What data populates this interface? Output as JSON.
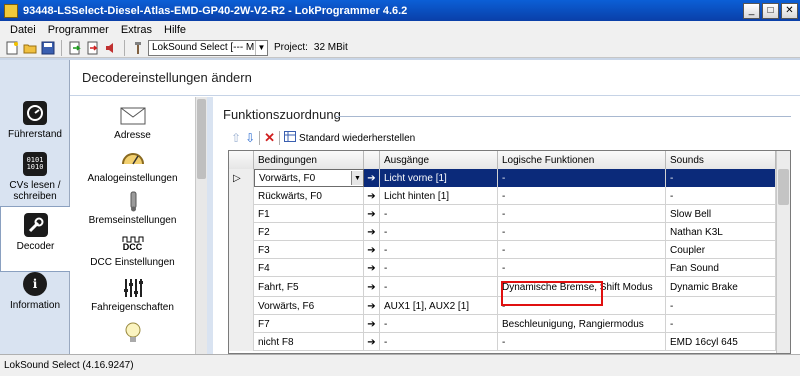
{
  "window": {
    "title": "93448-LSSelect-Diesel-Atlas-EMD-GP40-2W-V2-R2 - LokProgrammer 4.6.2",
    "btn_min": "_",
    "btn_max": "□",
    "btn_close": "✕"
  },
  "menu": [
    "Datei",
    "Programmer",
    "Extras",
    "Hilfe"
  ],
  "toolbar": {
    "decoder_select": "LokSound Select [--- MBit]",
    "project_label": "Project:",
    "project_value": "32 MBit"
  },
  "nav": [
    {
      "label": "Führerstand",
      "icon": "gauge-icon"
    },
    {
      "label": "CVs lesen / schreiben",
      "icon": "binary-icon"
    },
    {
      "label": "Decoder",
      "icon": "wrench-icon",
      "active": true
    },
    {
      "label": "Information",
      "icon": "info-icon"
    }
  ],
  "main": {
    "header": "Decodereinstellungen ändern"
  },
  "categories": [
    {
      "label": "Adresse",
      "icon": "envelope-icon"
    },
    {
      "label": "Analogeinstellungen",
      "icon": "analog-meter-icon"
    },
    {
      "label": "Bremseinstellungen",
      "icon": "brake-icon"
    },
    {
      "label": "DCC Einstellungen",
      "icon": "dcc-icon"
    },
    {
      "label": "Fahreigenschaften",
      "icon": "sliders-icon"
    },
    {
      "label": "",
      "icon": "lightbulb-icon"
    }
  ],
  "content": {
    "section_title": "Funktionszuordnung",
    "restore_label": "Standard wiederherstellen"
  },
  "grid": {
    "headers": [
      "",
      "Bedingungen",
      "",
      "Ausgänge",
      "Logische Funktionen",
      "Sounds"
    ],
    "rows": [
      {
        "indicator": "▷",
        "cond": "Vorwärts, F0",
        "arrow": "➔",
        "out": "Licht vorne [1]",
        "logic": "-",
        "sound": "-",
        "selected": true
      },
      {
        "indicator": "",
        "cond": "Rückwärts, F0",
        "arrow": "➔",
        "out": "Licht hinten [1]",
        "logic": "-",
        "sound": "-"
      },
      {
        "indicator": "",
        "cond": "F1",
        "arrow": "➔",
        "out": "-",
        "logic": "-",
        "sound": "Slow Bell"
      },
      {
        "indicator": "",
        "cond": "F2",
        "arrow": "➔",
        "out": "-",
        "logic": "-",
        "sound": "Nathan K3L"
      },
      {
        "indicator": "",
        "cond": "F3",
        "arrow": "➔",
        "out": "-",
        "logic": "-",
        "sound": "Coupler"
      },
      {
        "indicator": "",
        "cond": "F4",
        "arrow": "➔",
        "out": "-",
        "logic": "-",
        "sound": "Fan Sound"
      },
      {
        "indicator": "",
        "cond": "Fahrt, F5",
        "arrow": "➔",
        "out": "-",
        "logic": "Dynamische Bremse, Shift Modus",
        "sound": "Dynamic Brake"
      },
      {
        "indicator": "",
        "cond": "Vorwärts, F6",
        "arrow": "➔",
        "out": "AUX1 [1], AUX2 [1]",
        "logic": "-",
        "sound": "-"
      },
      {
        "indicator": "",
        "cond": "F7",
        "arrow": "➔",
        "out": "-",
        "logic": "Beschleunigung, Rangiermodus",
        "sound": "-"
      },
      {
        "indicator": "",
        "cond": "nicht F8",
        "arrow": "➔",
        "out": "-",
        "logic": "-",
        "sound": "EMD 16cyl 645"
      }
    ]
  },
  "status": {
    "text": "LokSound Select (4.16.9247)"
  },
  "colors": {
    "selection": "#0b2a7a",
    "highlight": "#e01010"
  }
}
